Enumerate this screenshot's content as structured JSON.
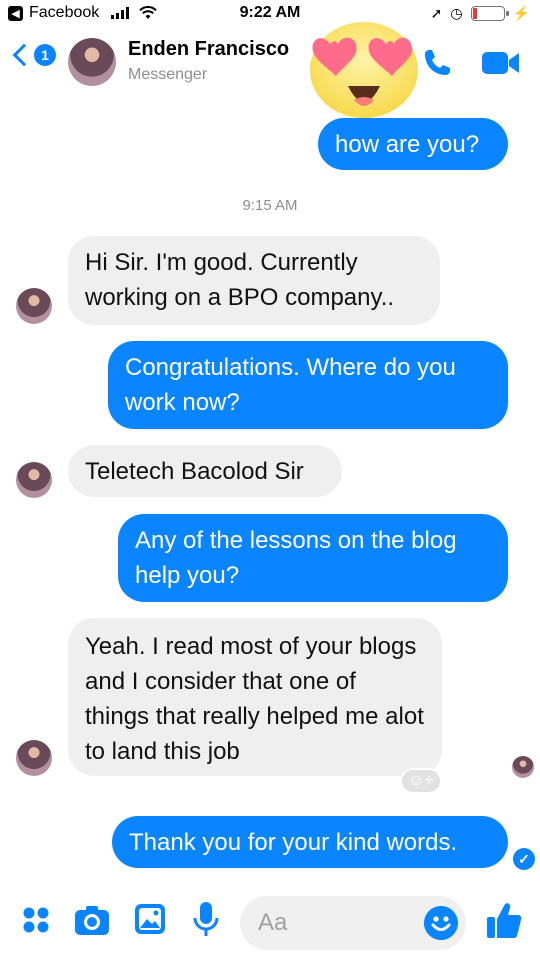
{
  "status_bar": {
    "back_app": "Facebook",
    "time": "9:22 AM"
  },
  "header": {
    "back_count": "1",
    "contact_name": "Enden Francisco",
    "contact_subtitle": "Messenger"
  },
  "messages": [
    {
      "side": "out",
      "text": "how are you?"
    },
    {
      "side": "in",
      "text": "Hi Sir. I'm good. Currently working on a BPO company.."
    },
    {
      "side": "out",
      "text": "Congratulations. Where do you work now?"
    },
    {
      "side": "in",
      "text": "Teletech Bacolod Sir"
    },
    {
      "side": "out",
      "text": "Any of the lessons on the blog help you?"
    },
    {
      "side": "in",
      "text": "Yeah. I read most of your blogs and I consider that one of things that really helped me alot to land this job"
    },
    {
      "side": "out",
      "text": "Thank you for your kind words."
    }
  ],
  "timestamp": "9:15 AM",
  "composer": {
    "placeholder": "Aa"
  },
  "icons": [
    "facebook-back-icon",
    "signal-icon",
    "wifi-icon",
    "location-icon",
    "alarm-icon",
    "battery-icon",
    "charging-icon",
    "back-chevron-icon",
    "phone-icon",
    "video-camera-icon",
    "heart-eyes-emoji",
    "add-reaction-icon",
    "sent-check-icon",
    "apps-grid-icon",
    "camera-icon",
    "photo-icon",
    "microphone-icon",
    "smiley-icon",
    "thumbs-up-icon"
  ],
  "colors": {
    "accent": "#0a84ff",
    "incoming_bubble": "#efefef",
    "outgoing_text": "#ffffff",
    "battery_low": "#e53935"
  },
  "battery_level": 0.1
}
